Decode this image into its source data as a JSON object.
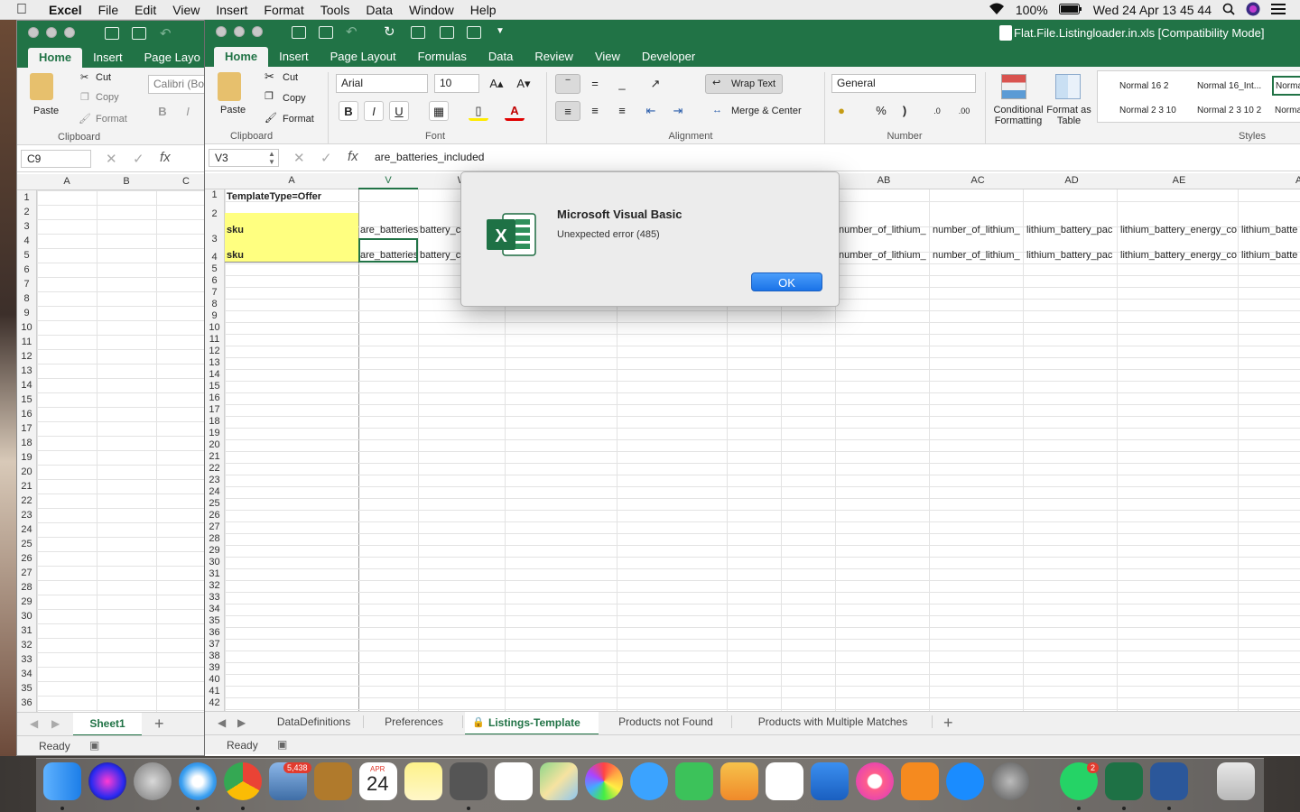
{
  "menubar": {
    "app": "Excel",
    "items": [
      "File",
      "Edit",
      "View",
      "Insert",
      "Format",
      "Tools",
      "Data",
      "Window",
      "Help"
    ],
    "battery": "100%",
    "clock": "Wed 24 Apr  13 45 44"
  },
  "back_window": {
    "tabs": [
      "Home",
      "Insert",
      "Page Layo"
    ],
    "clipboard": {
      "paste": "Paste",
      "cut": "Cut",
      "copy": "Copy",
      "format": "Format",
      "group": "Clipboard"
    },
    "font_name": "Calibri (Bo",
    "name_box": "C9",
    "columns": [
      "A",
      "B",
      "C"
    ],
    "sheet_tab": "Sheet1",
    "status": "Ready"
  },
  "main_window": {
    "title": "Flat.File.Listingloader.in.xls  [Compatibility Mode]",
    "tabs": [
      "Home",
      "Insert",
      "Page Layout",
      "Formulas",
      "Data",
      "Review",
      "View",
      "Developer"
    ],
    "clipboard": {
      "paste": "Paste",
      "cut": "Cut",
      "copy": "Copy",
      "format": "Format",
      "group": "Clipboard"
    },
    "font": {
      "name": "Arial",
      "size": "10",
      "group": "Font",
      "bold": "B",
      "italic": "I",
      "underline": "U"
    },
    "alignment": {
      "wrap": "Wrap Text",
      "merge": "Merge & Center",
      "group": "Alignment"
    },
    "number": {
      "format": "General",
      "percent": "%",
      "comma": ")",
      "group": "Number"
    },
    "styles": {
      "conditional": "Conditional Formatting",
      "format_table": "Format as Table",
      "cells": [
        "Normal 16 2",
        "Normal 16_Int...",
        "Norma",
        "Normal 2 3 10",
        "Normal 2 3 10 2",
        "Norma"
      ],
      "group": "Styles"
    },
    "name_box": "V3",
    "formula": "are_batteries_included",
    "columns": [
      "A",
      "V",
      "W",
      "AB",
      "AC",
      "AD",
      "AE",
      "A"
    ],
    "row_numbers": [
      "1",
      "2",
      "3",
      "4",
      "5",
      "6",
      "7",
      "8",
      "9",
      "10",
      "11",
      "12",
      "13",
      "14",
      "15",
      "16",
      "17",
      "18",
      "19",
      "20",
      "21",
      "22",
      "23",
      "24",
      "25",
      "26",
      "27",
      "28",
      "29",
      "30",
      "31",
      "32",
      "33",
      "34",
      "35",
      "36",
      "37",
      "38",
      "39",
      "40",
      "41",
      "42"
    ],
    "cells": {
      "a1": "TemplateType=Offer",
      "a2": "sku",
      "a3": "sku",
      "v2": "are_batteries",
      "v3": "are_batteries",
      "w2": "battery_c",
      "w3": "battery_c",
      "ab2": "number_of_lithium_",
      "ab3": "number_of_lithium_",
      "ac2": "number_of_lithium_",
      "ac3": "number_of_lithium_",
      "ad2": "lithium_battery_pac",
      "ad3": "lithium_battery_pac",
      "ae2": "lithium_battery_energy_co",
      "ae3": "lithium_battery_energy_co",
      "af2": "lithium_batte",
      "af3": "lithium_batte"
    },
    "sheet_tabs": [
      "DataDefinitions",
      "Preferences",
      "Listings-Template",
      "Products not Found",
      "Products with Multiple Matches"
    ],
    "status": "Ready"
  },
  "dialog": {
    "title": "Microsoft Visual Basic",
    "message": "Unexpected error (485)",
    "ok": "OK"
  },
  "dock": {
    "mail_badge": "5,438",
    "calendar_month": "APR",
    "calendar_day": "24",
    "whatsapp_badge": "2"
  }
}
